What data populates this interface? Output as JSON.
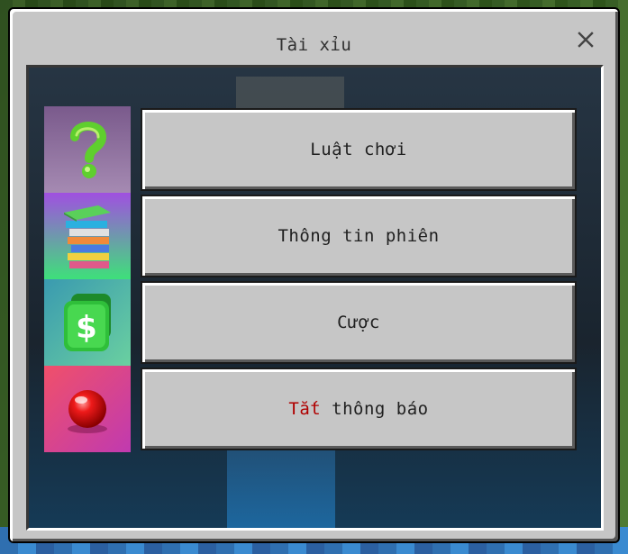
{
  "window": {
    "title": "Tài xỉu",
    "close_glyph": "✕"
  },
  "menu": {
    "items": [
      {
        "icon": "question-mark-icon",
        "label": "Luật chơi"
      },
      {
        "icon": "book-stack-icon",
        "label": "Thông tin phiên"
      },
      {
        "icon": "money-icon",
        "label": "Cược"
      },
      {
        "icon": "red-ball-icon",
        "label_prefix": "Tắt",
        "label_rest": " thông báo"
      }
    ]
  },
  "colors": {
    "dialog_bg": "#c6c6c6",
    "panel_bg": "#1d2a35",
    "text": "#1f1f1f",
    "warning_text": "#b00000"
  }
}
